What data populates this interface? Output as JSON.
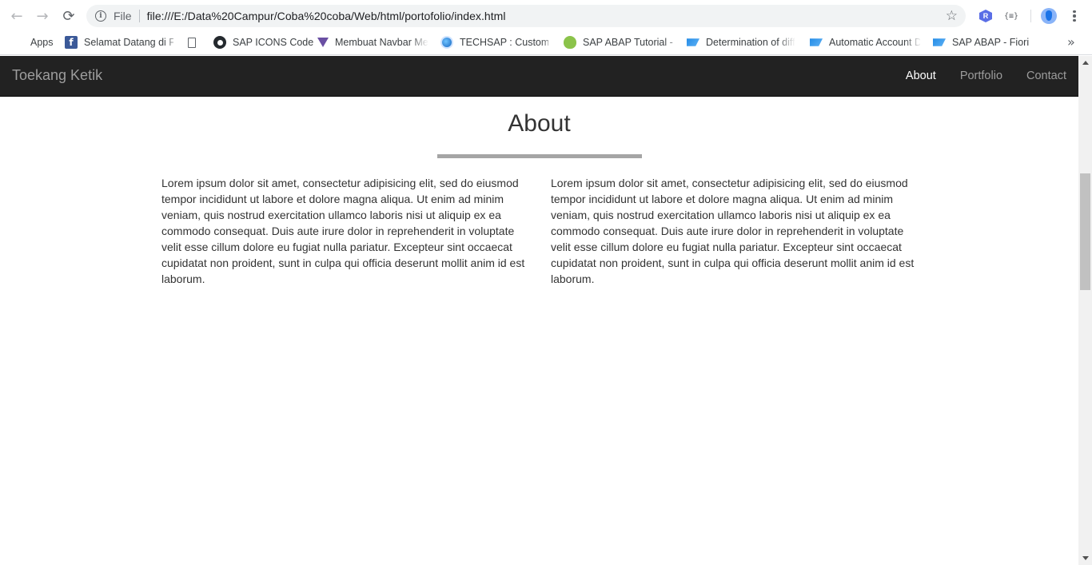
{
  "browser": {
    "back_icon": "←",
    "forward_icon": "→",
    "reload_icon": "⟳",
    "scheme_label": "File",
    "url": "file:///E:/Data%20Campur/Coba%20coba/Web/html/portofolio/index.html",
    "star_icon": "☆",
    "extension_r_label": "R",
    "extension_json_label": "{≡}"
  },
  "bookmarks": {
    "apps_label": "Apps",
    "items": [
      {
        "label": "Selamat Datang di Fa",
        "icon": "facebook-icon"
      },
      {
        "label": "",
        "icon": "document-icon"
      },
      {
        "label": "SAP ICONS Code",
        "icon": "github-icon"
      },
      {
        "label": "Membuat Navbar Me",
        "icon": "cube-icon"
      },
      {
        "label": "TECHSAP : Customer",
        "icon": "globe-icon"
      },
      {
        "label": "SAP ABAP Tutorial - A",
        "icon": "tree-icon"
      },
      {
        "label": "Determination of diff",
        "icon": "sap-icon"
      },
      {
        "label": "Automatic Account D",
        "icon": "sap-icon"
      },
      {
        "label": "SAP ABAP - Fiori",
        "icon": "sap-icon"
      }
    ],
    "overflow_icon": "»"
  },
  "site": {
    "brand": "Toekang Ketik",
    "nav": [
      {
        "label": "About",
        "active": true
      },
      {
        "label": "Portfolio",
        "active": false
      },
      {
        "label": "Contact",
        "active": false
      }
    ]
  },
  "about": {
    "title": "About",
    "left_text": "Lorem ipsum dolor sit amet, consectetur adipisicing elit, sed do eiusmod tempor incididunt ut labore et dolore magna aliqua. Ut enim ad minim veniam, quis nostrud exercitation ullamco laboris nisi ut aliquip ex ea commodo consequat. Duis aute irure dolor in reprehenderit in voluptate velit esse cillum dolore eu fugiat nulla pariatur. Excepteur sint occaecat cupidatat non proident, sunt in culpa qui officia deserunt mollit anim id est laborum.",
    "right_text": "Lorem ipsum dolor sit amet, consectetur adipisicing elit, sed do eiusmod tempor incididunt ut labore et dolore magna aliqua. Ut enim ad minim veniam, quis nostrud exercitation ullamco laboris nisi ut aliquip ex ea commodo consequat. Duis aute irure dolor in reprehenderit in voluptate velit esse cillum dolore eu fugiat nulla pariatur. Excepteur sint occaecat cupidatat non proident, sunt in culpa qui officia deserunt mollit anim id est laborum."
  },
  "colors": {
    "navbar_bg": "#222222",
    "nav_text": "#9d9d9d",
    "nav_active": "#ffffff",
    "rule": "#a5a5a5",
    "body_text": "#333333"
  }
}
